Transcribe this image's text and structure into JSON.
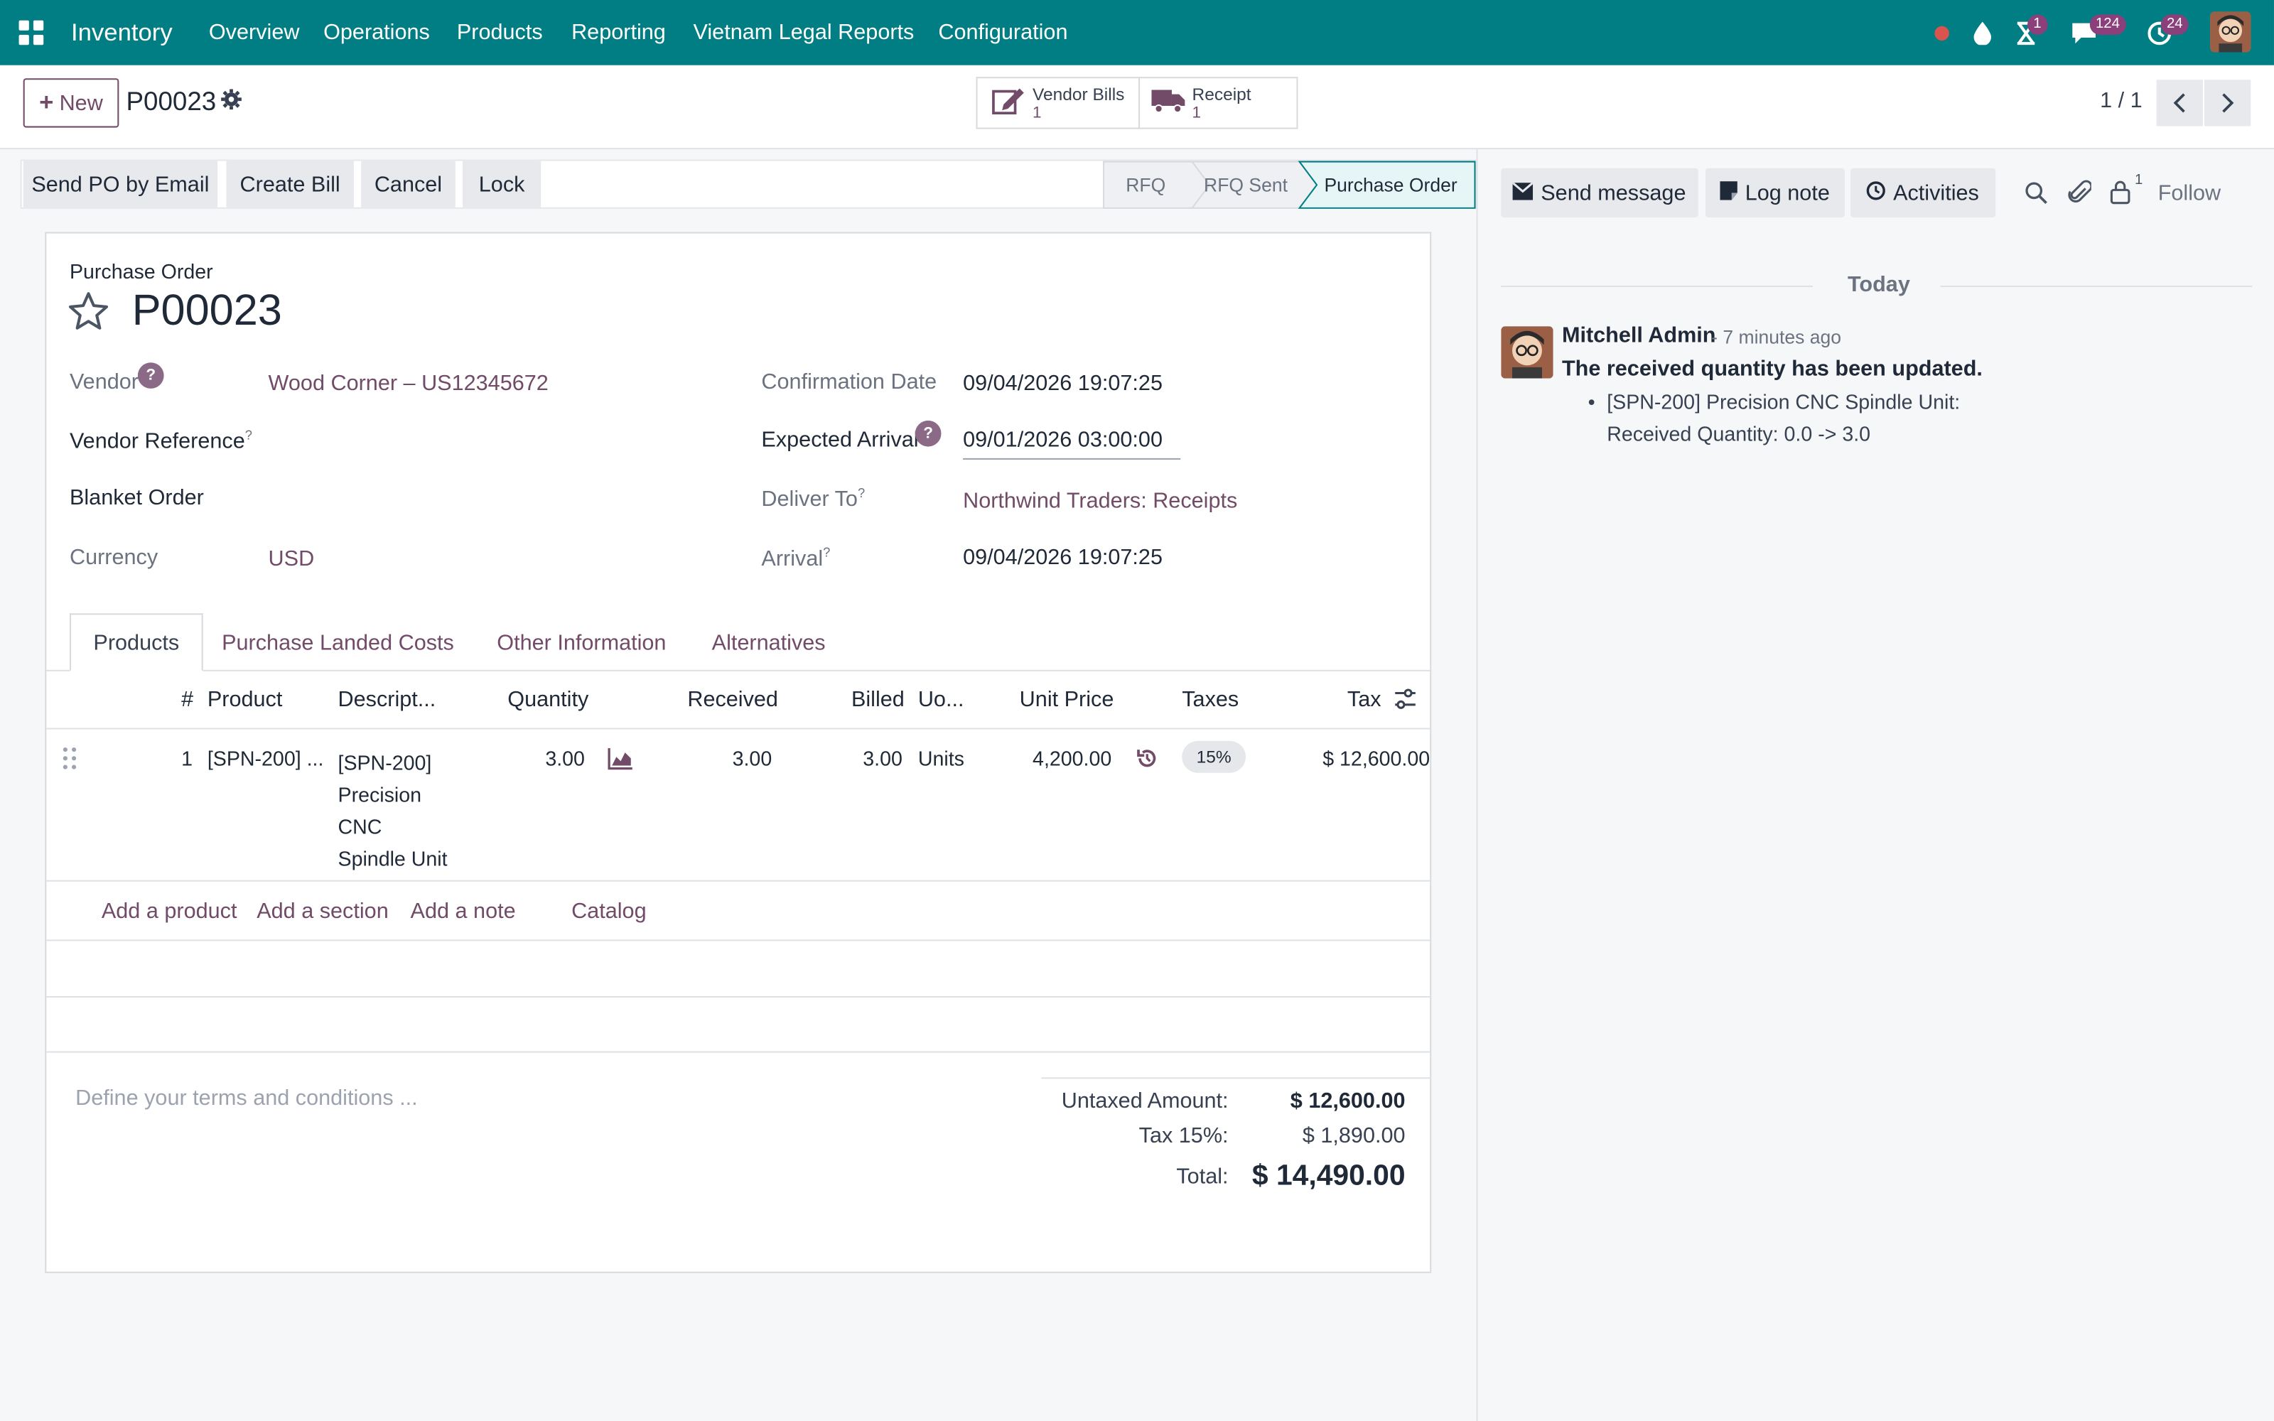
{
  "navbar": {
    "app_name": "Inventory",
    "menu": [
      "Overview",
      "Operations",
      "Products",
      "Reporting",
      "Vietnam Legal Reports",
      "Configuration"
    ],
    "activity_badge": "1",
    "messages_badge": "124",
    "updates_badge": "24"
  },
  "control": {
    "new_label": "New",
    "record_name": "P00023",
    "vendor_bills_label": "Vendor Bills",
    "vendor_bills_count": "1",
    "receipt_label": "Receipt",
    "receipt_count": "1",
    "pager": "1 / 1"
  },
  "actions": {
    "send_po": "Send PO by Email",
    "create_bill": "Create Bill",
    "cancel": "Cancel",
    "lock": "Lock"
  },
  "stages": {
    "rfq": "RFQ",
    "rfq_sent": "RFQ Sent",
    "purchase_order": "Purchase Order"
  },
  "form": {
    "type_label": "Purchase Order",
    "name": "P00023",
    "vendor_label": "Vendor",
    "vendor_value": "Wood Corner – US12345672",
    "vendor_ref_label": "Vendor Reference",
    "blanket_label": "Blanket Order",
    "currency_label": "Currency",
    "currency_value": "USD",
    "confirmation_label": "Confirmation Date",
    "confirmation_value": "09/04/2026 19:07:25",
    "expected_label": "Expected Arrival",
    "expected_value": "09/01/2026 03:00:00",
    "deliver_label": "Deliver To",
    "deliver_value": "Northwind Traders: Receipts",
    "arrival_label": "Arrival",
    "arrival_value": "09/04/2026 19:07:25"
  },
  "tabs": [
    "Products",
    "Purchase Landed Costs",
    "Other Information",
    "Alternatives"
  ],
  "table": {
    "headers": {
      "num": "#",
      "product": "Product",
      "description": "Descript...",
      "quantity": "Quantity",
      "received": "Received",
      "billed": "Billed",
      "uom": "Uo...",
      "unit_price": "Unit Price",
      "taxes": "Taxes",
      "tax": "Tax"
    },
    "row": {
      "num": "1",
      "product": "[SPN-200] ...",
      "description_lines": [
        "[SPN-200]",
        "Precision",
        "CNC",
        "Spindle Unit"
      ],
      "quantity": "3.00",
      "received": "3.00",
      "billed": "3.00",
      "uom": "Units",
      "unit_price": "4,200.00",
      "tax_badge": "15%",
      "tax_amount": "$ 12,600.00"
    },
    "add_product": "Add a product",
    "add_section": "Add a section",
    "add_note": "Add a note",
    "catalog": "Catalog"
  },
  "footer": {
    "terms_placeholder": "Define your terms and conditions ...",
    "untaxed_label": "Untaxed Amount:",
    "untaxed_value": "$ 12,600.00",
    "tax_label": "Tax 15%:",
    "tax_value": "$ 1,890.00",
    "total_label": "Total:",
    "total_value": "$ 14,490.00"
  },
  "chatter": {
    "send_message": "Send message",
    "log_note": "Log note",
    "activities": "Activities",
    "followers_count": "1",
    "follow": "Follow",
    "date_separator": "Today",
    "message": {
      "author": "Mitchell Admin",
      "time": "- 7 minutes ago",
      "title": "The received quantity has been updated.",
      "line1": "[SPN-200] Precision CNC Spindle Unit:",
      "line2": "Received Quantity: 0.0 -> 3.0"
    }
  },
  "colors": {
    "navbar": "#017e84",
    "brand": "#714b67",
    "active_stage": "#e6f6f7"
  }
}
